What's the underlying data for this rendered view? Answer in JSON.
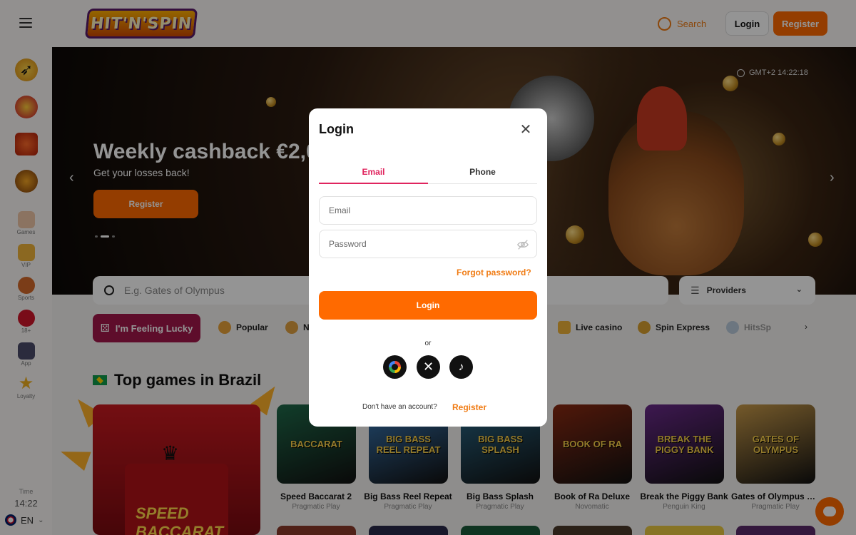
{
  "header": {
    "logo_text": "HIT'N'SPIN",
    "search_label": "Search",
    "login_label": "Login",
    "register_label": "Register"
  },
  "sidebar": {
    "promos": [
      "rocket-promo",
      "cherry-promo",
      "gift-promo",
      "coin-promo"
    ],
    "items": [
      {
        "label": "Games",
        "icon": "dice-icon"
      },
      {
        "label": "VIP",
        "icon": "crown-icon"
      },
      {
        "label": "Sports",
        "icon": "ball-icon"
      },
      {
        "label": "18+",
        "icon": "lips-icon"
      },
      {
        "label": "App",
        "icon": "phone-icon"
      },
      {
        "label": "Loyalty",
        "icon": "star-icon"
      }
    ],
    "time_label": "Time",
    "time_value": "14:22",
    "language": "EN"
  },
  "banner": {
    "title": "Weekly cashback €2,00",
    "subtitle": "Get your losses back!",
    "button_label": "Register",
    "clock": "GMT+2 14:22:18"
  },
  "search": {
    "placeholder": "E.g. Gates of Olympus",
    "providers_label": "Providers"
  },
  "categories": {
    "lucky_label": "I'm Feeling Lucky",
    "items": [
      "Popular",
      "N",
      "Live casino",
      "Spin Express",
      "HitsSp"
    ]
  },
  "section": {
    "title": "Top games in Brazil"
  },
  "games": [
    {
      "name": "Speed Baccarat 2",
      "provider": "Pragmatic Play",
      "art": "BACCARAT",
      "color": "#1f6a4a"
    },
    {
      "name": "Big Bass Reel Repeat",
      "provider": "Pragmatic Play",
      "art": "BIG BASS REEL REPEAT",
      "color": "#3a7ab8"
    },
    {
      "name": "Big Bass Splash",
      "provider": "Pragmatic Play",
      "art": "BIG BASS SPLASH",
      "color": "#2a6a8a"
    },
    {
      "name": "Book of Ra Deluxe",
      "provider": "Novomatic",
      "art": "BOOK OF RA",
      "color": "#8a2a12"
    },
    {
      "name": "Break the Piggy Bank",
      "provider": "Penguin King",
      "art": "BREAK THE PIGGY BANK",
      "color": "#6a2a8a"
    },
    {
      "name": "Gates of Olympus Super Scatter",
      "provider": "Pragmatic Play",
      "art": "GATES OF OLYMPUS",
      "color": "#c89a4a"
    }
  ],
  "featured": {
    "art": "SPEED BACCARAT"
  },
  "modal": {
    "title": "Login",
    "tab_email": "Email",
    "tab_phone": "Phone",
    "email_placeholder": "Email",
    "password_placeholder": "Password",
    "forgot_label": "Forgot password?",
    "login_button": "Login",
    "or_label": "or",
    "no_account_text": "Don't have an account?",
    "register_link": "Register"
  },
  "colors": {
    "accent": "#ff6a00",
    "tab_active": "#e0245e",
    "link": "#f07b13",
    "lucky": "#a2184a"
  }
}
